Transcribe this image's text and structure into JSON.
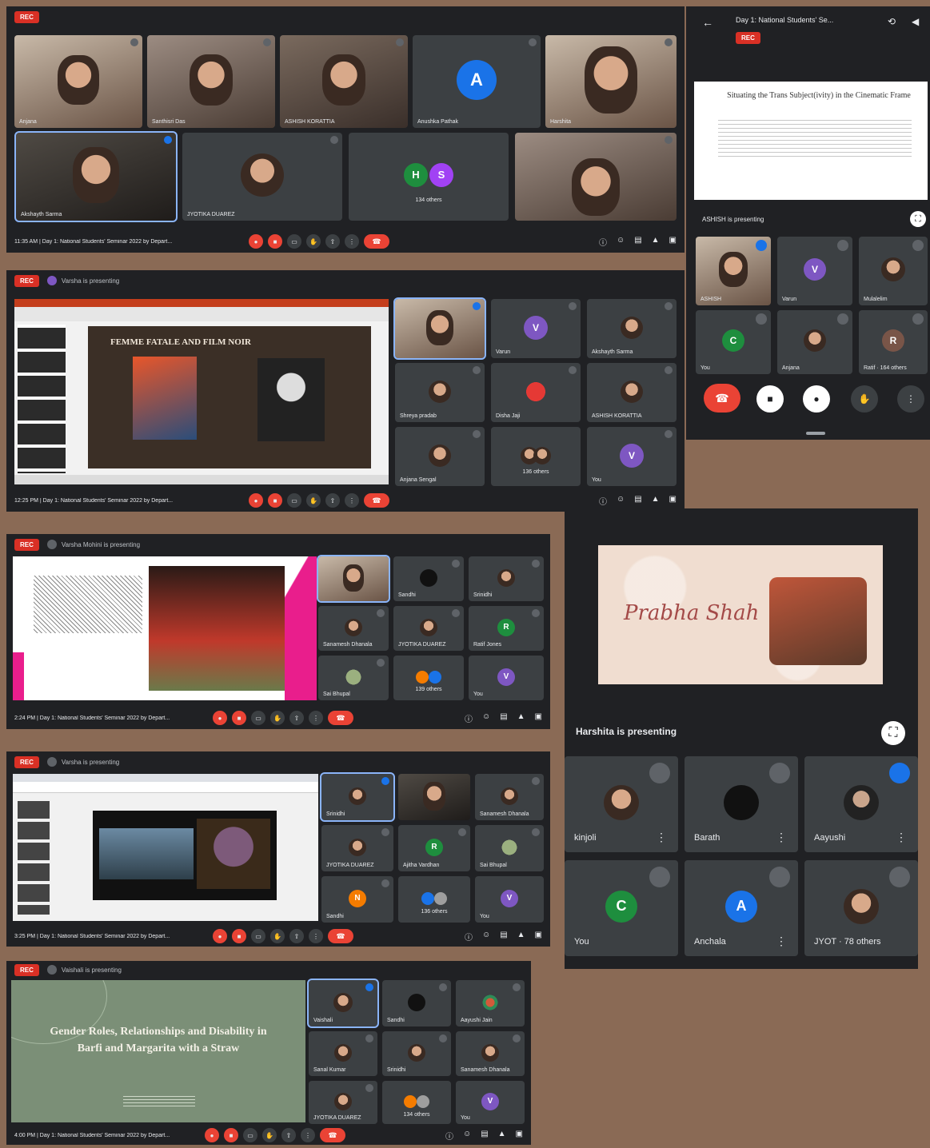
{
  "panel1": {
    "rec_label": "REC",
    "tiles": [
      {
        "name": "Anjana"
      },
      {
        "name": "Santhisri Das"
      },
      {
        "name": "ASHISH KORATTIA"
      },
      {
        "name": "Anushka Pathak",
        "initial": "A"
      },
      {
        "name": "Harshita"
      },
      {
        "name": "Akshayth Sarma"
      },
      {
        "name": "JYOTIKA DUAREZ"
      },
      {
        "name": "134 others",
        "initials": [
          "H",
          "S"
        ]
      },
      {
        "name": ""
      }
    ],
    "info": "11:35 AM  |  Day 1: National Students' Seminar 2022 by Depart..."
  },
  "phone": {
    "title": "Day 1: National Students' Se...",
    "rec_label": "REC",
    "slide_title": "Situating the Trans Subject(ivity) in the Cinematic Frame",
    "presenting": "ASHISH is presenting",
    "tiles": [
      {
        "name": "ASHISH"
      },
      {
        "name": "Varun",
        "initial": "V"
      },
      {
        "name": "Mulalelim"
      },
      {
        "name": "You",
        "initial": "C"
      },
      {
        "name": "Anjana"
      },
      {
        "name": "Ratif · 164 others",
        "initial": "R"
      }
    ]
  },
  "panel2": {
    "rec_label": "REC",
    "presenting": "Varsha is presenting",
    "slide_title": "FEMME FATALE AND FILM NOIR",
    "tiles": [
      {
        "name": ""
      },
      {
        "name": "Varun",
        "initial": "V"
      },
      {
        "name": "Akshayth Sarma"
      },
      {
        "name": "Shreya pradab"
      },
      {
        "name": "Disha Jaji"
      },
      {
        "name": "ASHISH KORATTIA"
      },
      {
        "name": "Anjana Sengal"
      },
      {
        "name": "136 others"
      },
      {
        "name": "You",
        "initial": "V"
      }
    ],
    "info": "12:25 PM  |  Day 1: National Students' Seminar 2022 by Depart..."
  },
  "panel3": {
    "rec_label": "REC",
    "presenting": "Varsha Mohini is presenting",
    "tiles": [
      {
        "name": ""
      },
      {
        "name": "Sandhi"
      },
      {
        "name": "Srinidhi"
      },
      {
        "name": "Sanamesh Dhanala"
      },
      {
        "name": "JYOTIKA DUAREZ"
      },
      {
        "name": "Ratif Jones",
        "initial": "R"
      },
      {
        "name": "Sai Bhupal"
      },
      {
        "name": "139 others"
      },
      {
        "name": "You",
        "initial": "V"
      }
    ],
    "info": "2:24 PM  |  Day 1: National Students' Seminar 2022 by Depart..."
  },
  "panel4": {
    "presenting_name": "Prabha Shah",
    "presenting": "Harshita is presenting",
    "tiles": [
      {
        "name": "kinjoli"
      },
      {
        "name": "Barath"
      },
      {
        "name": "Aayushi"
      },
      {
        "name": "You",
        "initial": "C"
      },
      {
        "name": "Anchala",
        "initial": "A"
      },
      {
        "name": "JYOT · 78 others"
      }
    ]
  },
  "panel5": {
    "rec_label": "REC",
    "presenting": "Varsha is presenting",
    "tiles": [
      {
        "name": "Srinidhi"
      },
      {
        "name": ""
      },
      {
        "name": "Sanamesh Dhanala"
      },
      {
        "name": "JYOTIKA DUAREZ"
      },
      {
        "name": "Ajitha Vardhan",
        "initial": "R"
      },
      {
        "name": "Sai Bhupal"
      },
      {
        "name": "Sandhi",
        "initial": "N"
      },
      {
        "name": "136 others"
      },
      {
        "name": "You",
        "initial": "V"
      }
    ],
    "info": "3:25 PM  |  Day 1: National Students' Seminar 2022 by Depart..."
  },
  "panel6": {
    "rec_label": "REC",
    "presenting": "Vaishali is presenting",
    "slide_title": "Gender Roles, Relationships and Disability in Barfi and Margarita with a Straw",
    "tiles": [
      {
        "name": "Vaishali"
      },
      {
        "name": "Sandhi"
      },
      {
        "name": "Aayushi Jain"
      },
      {
        "name": "Sanal Kumar"
      },
      {
        "name": "Srinidhi"
      },
      {
        "name": "Sanamesh Dhanala"
      },
      {
        "name": "JYOTIKA DUAREZ"
      },
      {
        "name": "134 others"
      },
      {
        "name": "You",
        "initial": "V"
      }
    ],
    "info": "4:00 PM  |  Day 1: National Students' Seminar 2022 by Depart..."
  },
  "colors": {
    "background": "#8a6a55",
    "meet_dark": "#202124",
    "tile": "#3c4043",
    "red": "#ea4335",
    "blue": "#1a73e8",
    "purple": "#7e57c2",
    "green": "#1e8e3e"
  },
  "icons": [
    "mic-icon",
    "camera-icon",
    "captions-icon",
    "raise-hand-icon",
    "present-icon",
    "more-icon",
    "hang-up-icon",
    "info-icon",
    "people-icon",
    "chat-icon",
    "activities-icon",
    "lock-icon",
    "back-arrow-icon",
    "switch-camera-icon",
    "speaker-icon",
    "fullscreen-icon"
  ]
}
